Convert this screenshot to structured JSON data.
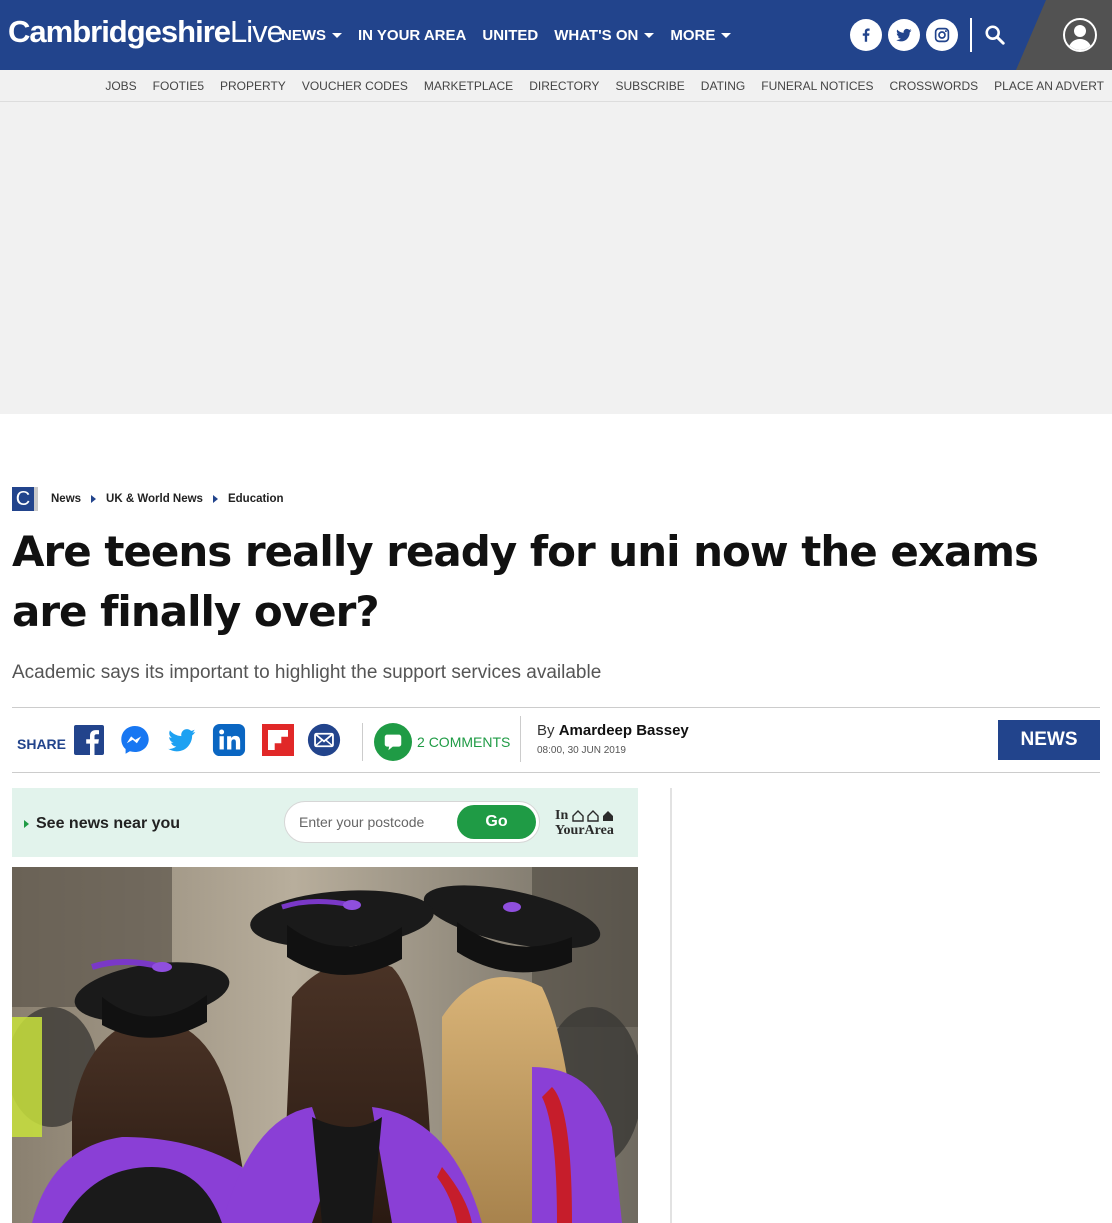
{
  "site": {
    "logo_bold": "Cambridgeshire",
    "logo_light": "Live"
  },
  "main_nav": [
    {
      "label": "NEWS",
      "has_dropdown": true
    },
    {
      "label": "IN YOUR AREA",
      "has_dropdown": false
    },
    {
      "label": "UNITED",
      "has_dropdown": false
    },
    {
      "label": "WHAT'S ON",
      "has_dropdown": true
    },
    {
      "label": "MORE",
      "has_dropdown": true
    }
  ],
  "header_icons": [
    "facebook-icon",
    "twitter-icon",
    "instagram-icon",
    "search-icon",
    "account-icon"
  ],
  "sub_nav": [
    "JOBS",
    "FOOTIE5",
    "PROPERTY",
    "VOUCHER CODES",
    "MARKETPLACE",
    "DIRECTORY",
    "SUBSCRIBE",
    "DATING",
    "FUNERAL NOTICES",
    "CROSSWORDS",
    "PLACE AN ADVERT"
  ],
  "breadcrumb": {
    "brand_letter": "C",
    "items": [
      "News",
      "UK & World News",
      "Education"
    ]
  },
  "article": {
    "headline": "Are teens really ready for uni now the exams are finally over?",
    "standfirst": "Academic says its important to highlight the support services available",
    "share_label": "SHARE",
    "comments_count": "2",
    "comments_label": "COMMENTS",
    "byline_prefix": "By",
    "author": "Amardeep Bassey",
    "date": "08:00, 30 JUN 2019",
    "section_badge": "NEWS"
  },
  "in_your_area": {
    "label": "See news near you",
    "placeholder": "Enter your postcode",
    "button": "Go",
    "logo_line1": "In",
    "logo_line2": "YourArea"
  },
  "colors": {
    "brand_blue": "#22448c",
    "comments_green": "#1f9b45",
    "iya_background": "#e2f3ec",
    "subnav_background": "#f1f1f1"
  }
}
